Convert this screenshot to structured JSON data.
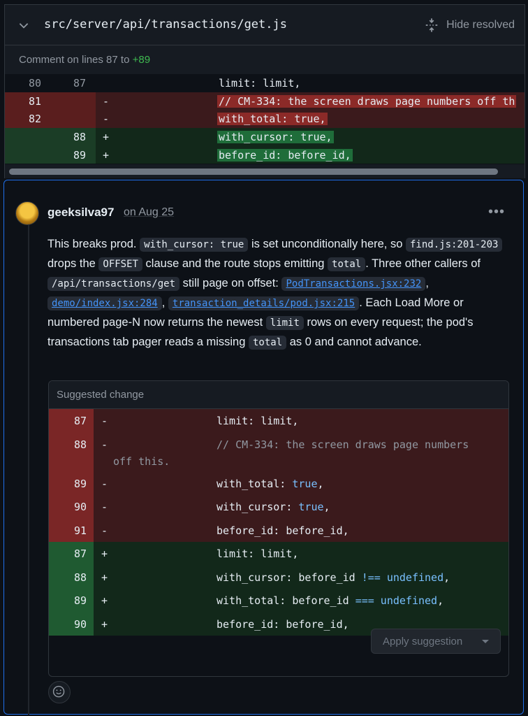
{
  "header": {
    "file_path": "src/server/api/transactions/get.js",
    "hide_resolved": "Hide resolved"
  },
  "comment_range": {
    "prefix": "Comment on lines 87 to ",
    "end": "+89"
  },
  "diff": [
    {
      "type": "ctx",
      "old": "80",
      "new": "87",
      "sign": "",
      "code": "limit: limit,"
    },
    {
      "type": "del",
      "old": "81",
      "new": "",
      "sign": "-",
      "code": "// CM-334: the screen draws page numbers off th"
    },
    {
      "type": "del",
      "old": "82",
      "new": "",
      "sign": "-",
      "code": "with_total: true,"
    },
    {
      "type": "add",
      "old": "",
      "new": "88",
      "sign": "+",
      "code": "with_cursor: true,"
    },
    {
      "type": "add",
      "old": "",
      "new": "89",
      "sign": "+",
      "code": "before_id: before_id,"
    }
  ],
  "comment": {
    "author": "geeksilva97",
    "date": "on Aug 25",
    "menu": "•••",
    "body": {
      "t1": "This breaks prod. ",
      "c1": "with_cursor: true",
      "t2": " is set unconditionally here, so ",
      "c2": "find.js:201-203",
      "t3": " drops the ",
      "c3": "OFFSET",
      "t4": " clause and the route stops emitting ",
      "c4": "total",
      "t5": ". Three other callers of ",
      "c5": "/api/transactions/get",
      "t6": " still page on offset: ",
      "l1": "PodTransactions.jsx:232",
      "t7": ", ",
      "l2": "demo/index.jsx:284",
      "t8": ", ",
      "l3": "transaction_details/pod.jsx:215",
      "t9": ". Each Load More or numbered page-N now returns the newest ",
      "c6": "limit",
      "t10": " rows on every request; the pod's transactions tab pager reads a missing ",
      "c7": "total",
      "t11": " as 0 and cannot advance."
    }
  },
  "suggestion": {
    "title": "Suggested change",
    "apply_label": "Apply suggestion",
    "rows": [
      {
        "type": "del",
        "num": "87",
        "sign": "-",
        "code": "limit: limit,"
      },
      {
        "type": "del",
        "num": "88",
        "sign": "-",
        "code": "// CM-334: the screen draws page numbers",
        "wrap": "off this."
      },
      {
        "type": "del",
        "num": "89",
        "sign": "-",
        "code": "with_total: ",
        "kw": "true",
        "tail": ","
      },
      {
        "type": "del",
        "num": "90",
        "sign": "-",
        "code": "with_cursor: ",
        "kw": "true",
        "tail": ","
      },
      {
        "type": "del",
        "num": "91",
        "sign": "-",
        "code": "before_id: before_id,"
      },
      {
        "type": "add",
        "num": "87",
        "sign": "+",
        "code": "limit: limit,"
      },
      {
        "type": "add",
        "num": "88",
        "sign": "+",
        "code": "with_cursor: before_id ",
        "kw": "!== undefined",
        "tail": ","
      },
      {
        "type": "add",
        "num": "89",
        "sign": "+",
        "code": "with_total: before_id ",
        "kw": "=== undefined",
        "tail": ","
      },
      {
        "type": "add",
        "num": "90",
        "sign": "+",
        "code": "before_id: before_id,"
      }
    ]
  }
}
